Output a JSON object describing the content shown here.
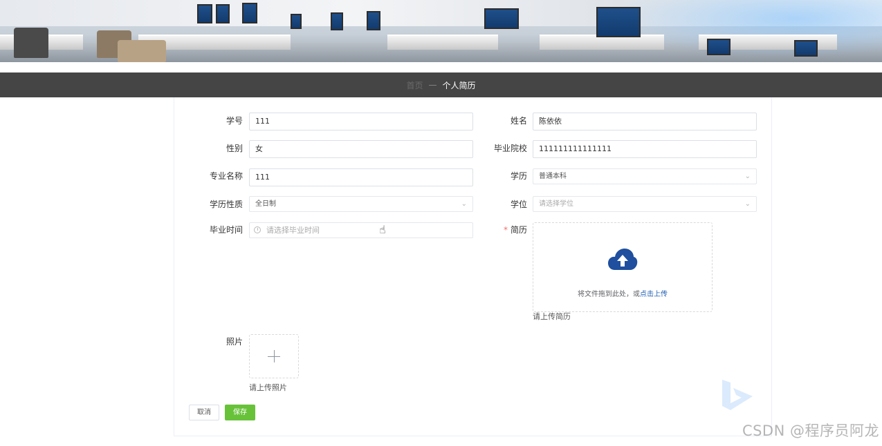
{
  "breadcrumb": {
    "home": "首页",
    "separator": "—",
    "current": "个人简历"
  },
  "form": {
    "student_id": {
      "label": "学号",
      "value": "111"
    },
    "name": {
      "label": "姓名",
      "value": "陈依依"
    },
    "gender": {
      "label": "性别",
      "value": "女"
    },
    "school": {
      "label": "毕业院校",
      "value": "111111111111111"
    },
    "major": {
      "label": "专业名称",
      "value": "111"
    },
    "education": {
      "label": "学历",
      "value": "普通本科"
    },
    "education_type": {
      "label": "学历性质",
      "value": "全日制"
    },
    "degree": {
      "label": "学位",
      "placeholder": "请选择学位"
    },
    "graduation_time": {
      "label": "毕业时间",
      "placeholder": "请选择毕业时间"
    },
    "resume": {
      "label": "简历",
      "drag_text": "将文件拖到此处，或",
      "click_text": "点击上传",
      "tip": "请上传简历"
    },
    "photo": {
      "label": "照片",
      "tip": "请上传照片"
    }
  },
  "buttons": {
    "cancel": "取消",
    "save": "保存"
  },
  "watermark": "CSDN @程序员阿龙",
  "colors": {
    "breadcrumb_bg": "#454545",
    "save_green": "#67c23a",
    "upload_icon": "#1f4f9e",
    "link": "#1f5fb4"
  },
  "icons": {
    "upload": "cloud-upload-icon",
    "plus": "plus-icon",
    "clock": "clock-icon",
    "dropdown": "chevron-down-icon"
  }
}
